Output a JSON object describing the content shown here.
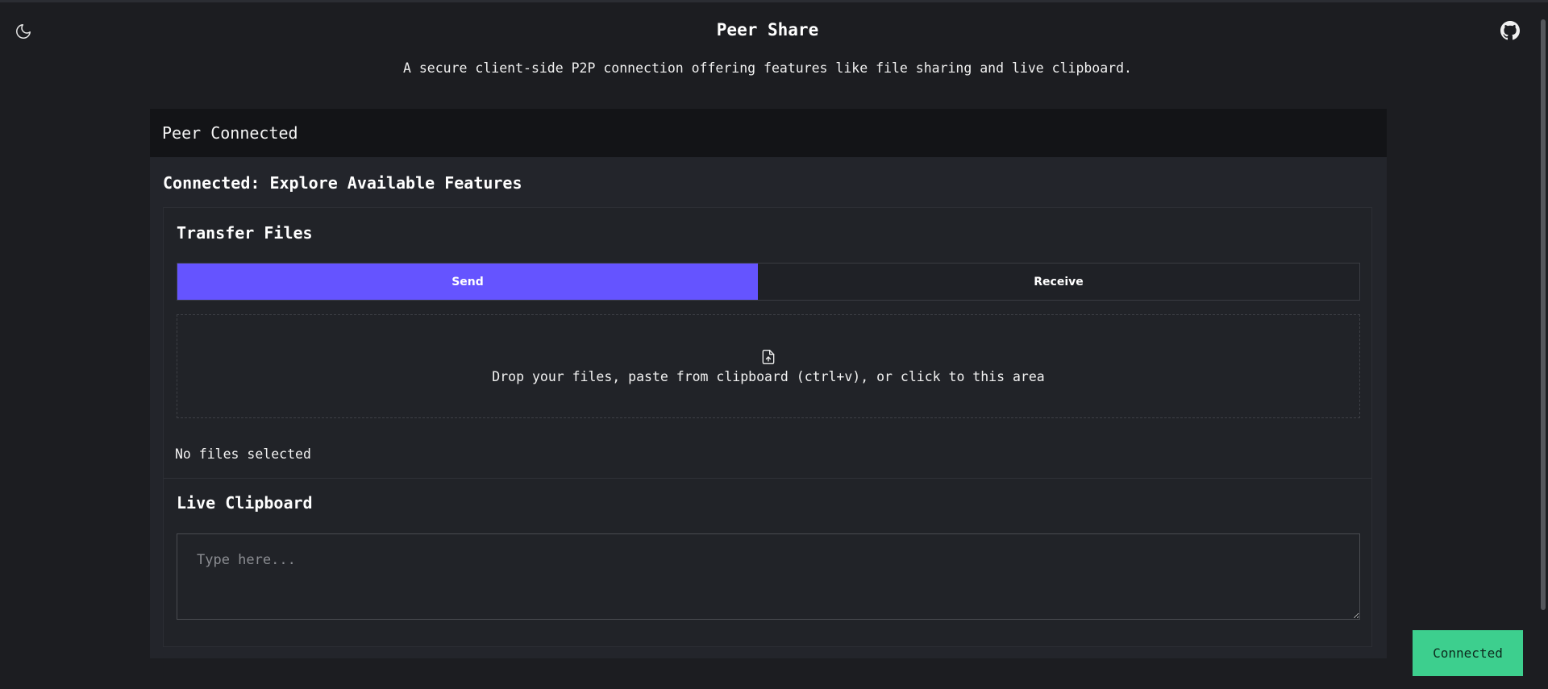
{
  "header": {
    "title": "Peer Share",
    "subtitle": "A secure client-side P2P connection offering features like file sharing and live clipboard.",
    "theme_icon": "moon-icon",
    "github_icon": "github-icon"
  },
  "card": {
    "header": "Peer Connected",
    "heading": "Connected: Explore Available Features"
  },
  "transfer": {
    "title": "Transfer Files",
    "tabs": [
      {
        "label": "Send",
        "active": true
      },
      {
        "label": "Receive",
        "active": false
      }
    ],
    "dropzone_text": "Drop your files, paste from clipboard (ctrl+v), or click to this area",
    "dropzone_icon": "file-upload-icon",
    "no_files": "No files selected"
  },
  "clipboard": {
    "title": "Live Clipboard",
    "placeholder": "Type here...",
    "value": ""
  },
  "status": {
    "label": "Connected",
    "color": "#3dcf8e"
  },
  "colors": {
    "accent": "#6554ff",
    "background": "#1c1d21",
    "card": "#23252b"
  }
}
